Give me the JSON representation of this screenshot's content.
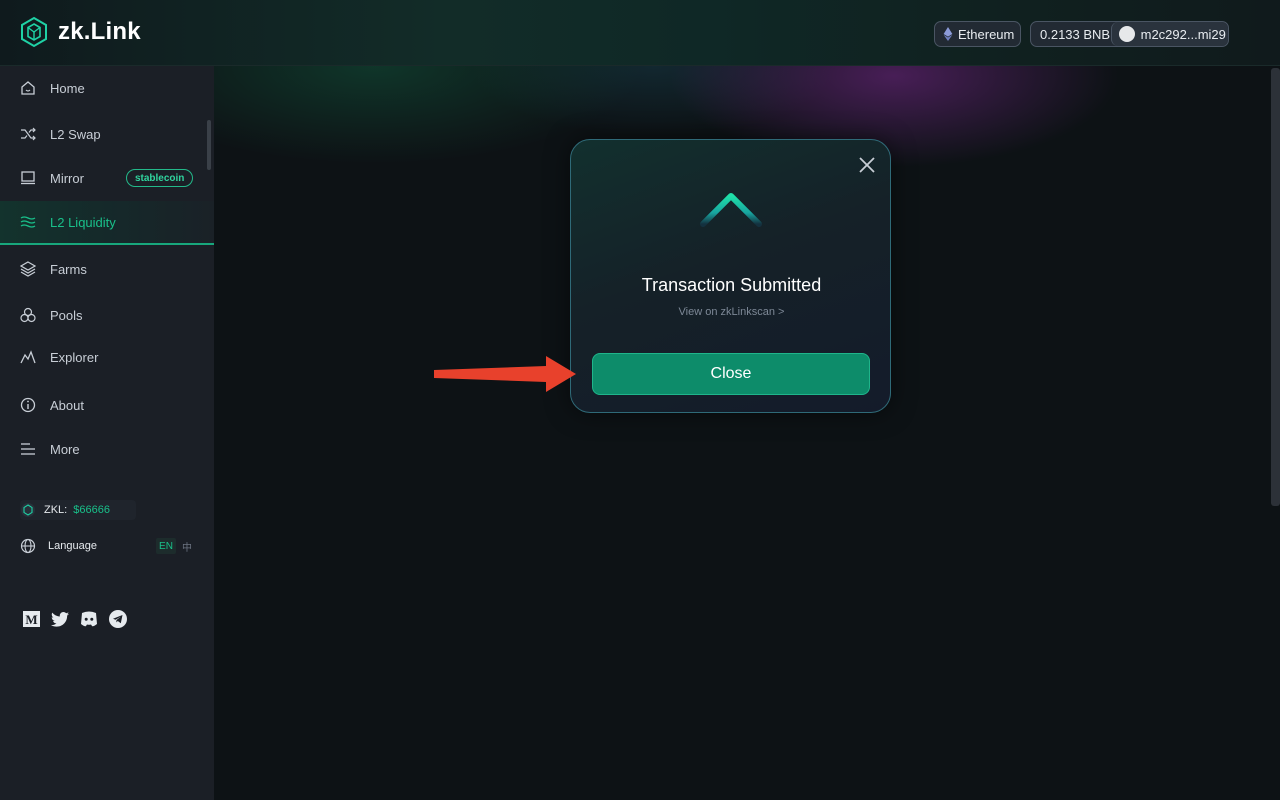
{
  "header": {
    "logo_text": "zk.Link",
    "network": "Ethereum",
    "balance": "0.2133 BNB",
    "address": "m2c292...mi29"
  },
  "sidebar": {
    "items": [
      {
        "label": "Home",
        "icon": "home-icon"
      },
      {
        "label": "L2 Swap",
        "icon": "swap-icon"
      },
      {
        "label": "Mirror",
        "icon": "mirror-icon",
        "badge": "stablecoin"
      },
      {
        "label": "L2 Liquidity",
        "icon": "liquidity-icon",
        "active": true
      },
      {
        "label": "Farms",
        "icon": "layers-icon"
      },
      {
        "label": "Pools",
        "icon": "pools-icon"
      },
      {
        "label": "Explorer",
        "icon": "chart-line-icon"
      },
      {
        "label": "About",
        "icon": "info-icon"
      },
      {
        "label": "More",
        "icon": "menu-icon"
      }
    ],
    "zkl_label": "ZKL:",
    "zkl_price": "$66666",
    "language_label": "Language",
    "lang_en": "EN",
    "lang_zh": "中",
    "socials": [
      "medium-icon",
      "twitter-icon",
      "discord-icon",
      "telegram-icon"
    ]
  },
  "modal": {
    "title": "Transaction Submitted",
    "link": "View on zkLinkscan >",
    "button": "Close"
  },
  "colors": {
    "accent": "#19c08a",
    "button": "#0d8c6a",
    "annotation_arrow": "#e8412c"
  }
}
